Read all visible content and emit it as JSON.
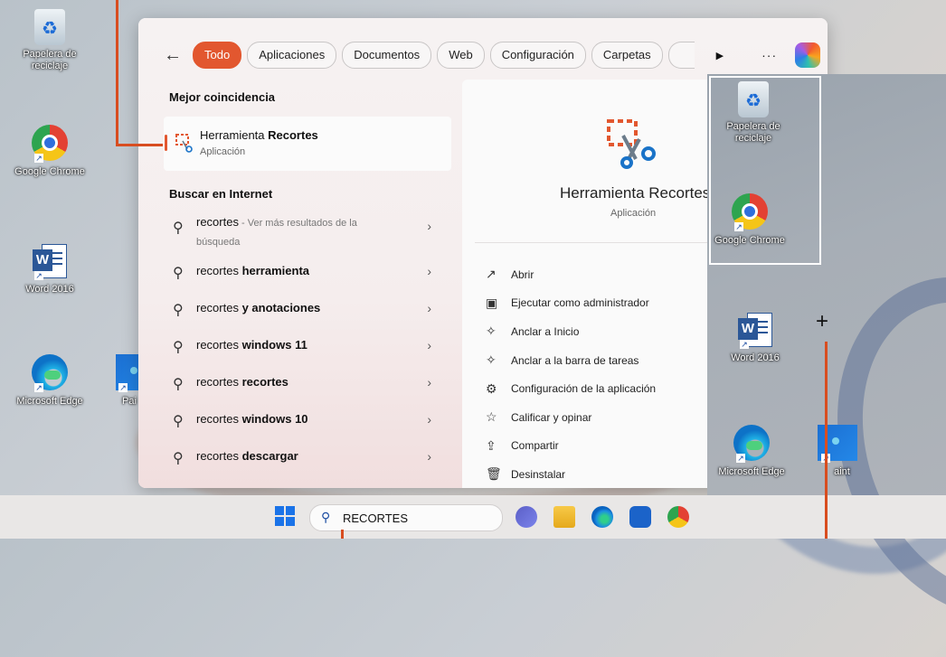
{
  "desktop": {
    "icons": [
      {
        "label": "Papelera de reciclaje",
        "icon": "recycle-bin-icon"
      },
      {
        "label": "Google Chrome",
        "icon": "chrome-icon"
      },
      {
        "label": "Word 2016",
        "icon": "word-icon"
      },
      {
        "label": "Microsoft Edge",
        "icon": "edge-icon"
      },
      {
        "label": "Pai",
        "icon": "paint-icon"
      }
    ]
  },
  "search": {
    "filters": [
      "Todo",
      "Aplicaciones",
      "Documentos",
      "Web",
      "Configuración",
      "Carpetas"
    ],
    "best_match_title": "Mejor coincidencia",
    "best_match": {
      "name_plain": "Herramienta ",
      "name_bold": "Recortes",
      "type": "Aplicación"
    },
    "web_title": "Buscar en Internet",
    "web_results": [
      {
        "plain": "recortes",
        "bold": "",
        "hint": " - Ver más resultados de la búsqueda"
      },
      {
        "plain": "recortes ",
        "bold": "herramienta",
        "hint": ""
      },
      {
        "plain": "recortes ",
        "bold": "y anotaciones",
        "hint": ""
      },
      {
        "plain": "recortes ",
        "bold": "windows 11",
        "hint": ""
      },
      {
        "plain": "recortes ",
        "bold": "recortes",
        "hint": ""
      },
      {
        "plain": "recortes ",
        "bold": "windows 10",
        "hint": ""
      },
      {
        "plain": "recortes ",
        "bold": "descargar",
        "hint": ""
      }
    ],
    "detail": {
      "name": "Herramienta Recortes",
      "type": "Aplicación",
      "actions": [
        {
          "label": "Abrir",
          "icon": "open-external-icon"
        },
        {
          "label": "Ejecutar como administrador",
          "icon": "admin-shield-icon"
        },
        {
          "label": "Anclar a Inicio",
          "icon": "pin-icon"
        },
        {
          "label": "Anclar a la barra de tareas",
          "icon": "pin-icon"
        },
        {
          "label": "Configuración de la aplicación",
          "icon": "gear-icon"
        },
        {
          "label": "Calificar y opinar",
          "icon": "rate-icon"
        },
        {
          "label": "Compartir",
          "icon": "share-icon"
        },
        {
          "label": "Desinstalar",
          "icon": "trash-icon"
        }
      ]
    }
  },
  "overlay": {
    "icons": [
      {
        "label": "Papelera de reciclaje"
      },
      {
        "label": "Google Chrome"
      },
      {
        "label": "Word 2016"
      },
      {
        "label": "Microsoft Edge"
      },
      {
        "label": "aint"
      }
    ]
  },
  "taskbar": {
    "search_value": "RECORTES",
    "apps": [
      "teams-icon",
      "file-explorer-icon",
      "edge-icon",
      "store-icon",
      "chrome-icon"
    ]
  },
  "colors": {
    "accent": "#e2572f",
    "annotation": "#d84d20"
  }
}
